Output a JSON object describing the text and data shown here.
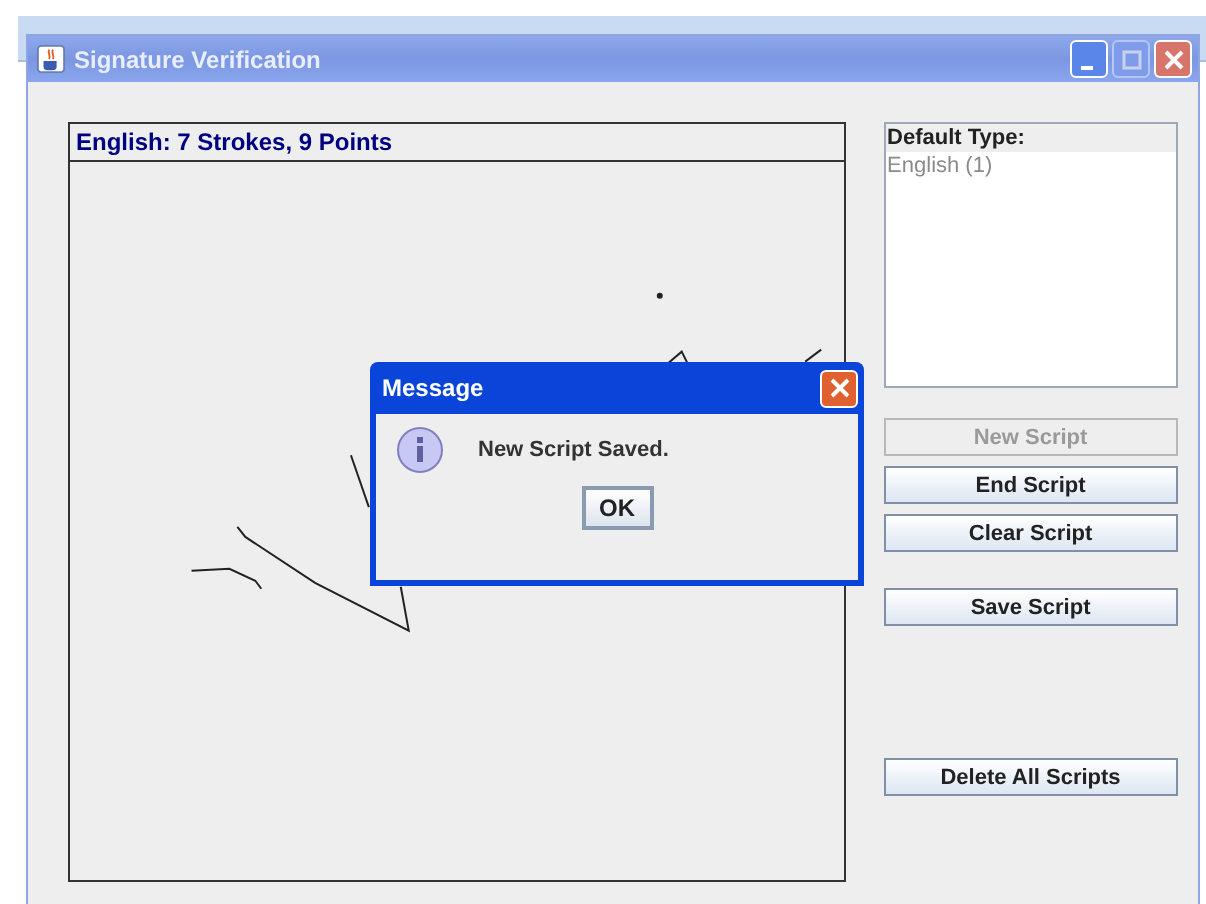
{
  "window": {
    "title": "Signature Verification"
  },
  "canvas": {
    "header": "English: 7 Strokes, 9 Points"
  },
  "type_list": {
    "heading": "Default Type:",
    "items": [
      {
        "label": "English (1)",
        "selected": false
      }
    ]
  },
  "button_groups": [
    [
      {
        "label": "New Script",
        "disabled": true
      },
      {
        "label": "End Script",
        "disabled": false
      },
      {
        "label": "Clear Script",
        "disabled": false
      }
    ],
    [
      {
        "label": "Save Script",
        "disabled": false
      }
    ],
    [
      {
        "label": "Delete All Scripts",
        "disabled": false
      }
    ]
  ],
  "dialog": {
    "title": "Message",
    "message": "New Script Saved.",
    "button": "OK"
  }
}
